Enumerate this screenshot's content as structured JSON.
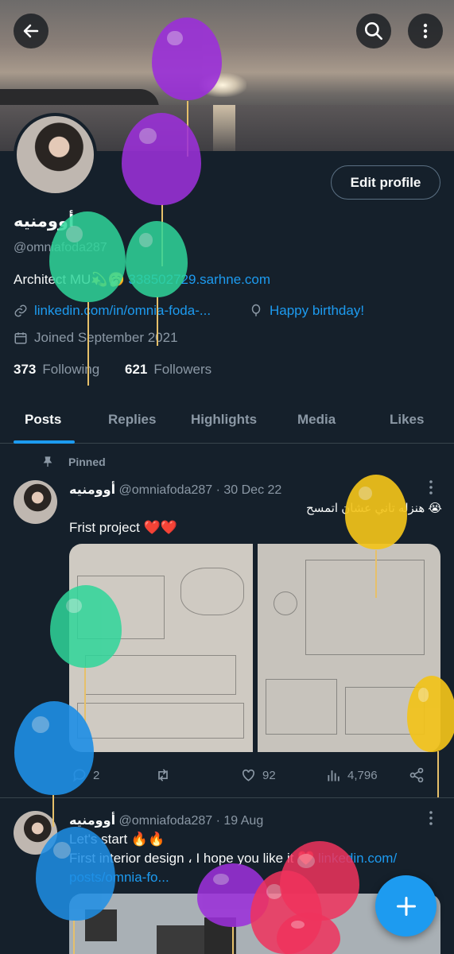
{
  "header": {
    "back_icon": "arrow-left-icon",
    "search_icon": "search-icon",
    "more_icon": "more-vertical-icon"
  },
  "profile": {
    "name": "أوومنيه",
    "handle": "@omniafoda287",
    "bio_text": "Architect MU💫🥱 ",
    "bio_link": "338502729.sarhne.com",
    "website": "linkedin.com/in/omnia-foda-...",
    "birthday": "Happy birthday!",
    "joined": "Joined September 2021",
    "following_count": "373",
    "following_label": "Following",
    "followers_count": "621",
    "followers_label": "Followers",
    "edit_button": "Edit profile"
  },
  "tabs": [
    "Posts",
    "Replies",
    "Highlights",
    "Media",
    "Likes"
  ],
  "posts": [
    {
      "pinned_label": "Pinned",
      "name": "أوومنيه",
      "handle": "@omniafoda287",
      "date": "· 30 Dec 22",
      "text": "Frist project ❤️❤️",
      "arabic_text": "هنزله تاني عشان اتمسح 😭",
      "replies": "2",
      "likes": "92",
      "views": "4,796"
    },
    {
      "name": "أوومنيه",
      "handle": "@omniafoda287",
      "date": "· 19 Aug",
      "line1": "Let's start 🔥🔥",
      "line2_text": "First interior design ، I hope you like it ❤️ ",
      "line2_link": "linkedin.com/",
      "line3_link": "posts/omnia-fo..."
    }
  ],
  "colors": {
    "background": "#15202b",
    "accent": "#1d9bf0",
    "muted": "#8b98a5",
    "like_red": "#f91880"
  }
}
